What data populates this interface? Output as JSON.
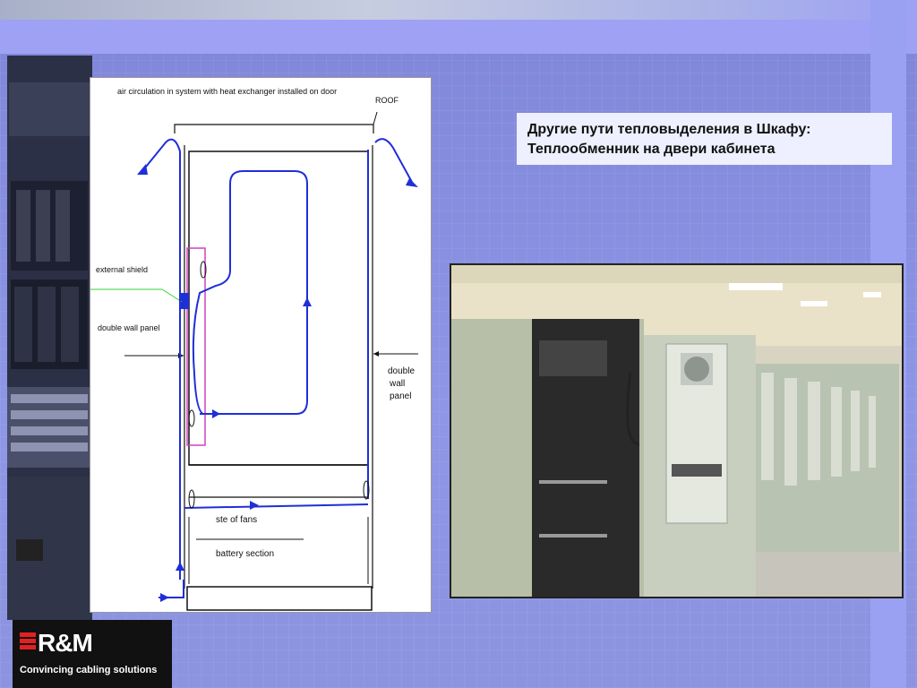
{
  "title": {
    "line1": "Другие пути тепловыделения в Шкафу:",
    "line2": "Теплообменник на двери кабинета"
  },
  "diagram": {
    "caption": "air circulation in system with heat exchanger installed on door",
    "roof": "ROOF",
    "external_shield": "external shield",
    "double_wall_panel_left": "double wall panel",
    "double_wall_panel_right_1": "double",
    "double_wall_panel_right_2": "wall",
    "double_wall_panel_right_3": "panel",
    "fans": "ste of fans",
    "battery": "battery section"
  },
  "logo": {
    "name": "R&M",
    "tagline": "Convincing cabling solutions"
  },
  "colors": {
    "accent": "#9ea1f4",
    "flow": "#1f2fd8",
    "brand_red": "#e32020"
  }
}
